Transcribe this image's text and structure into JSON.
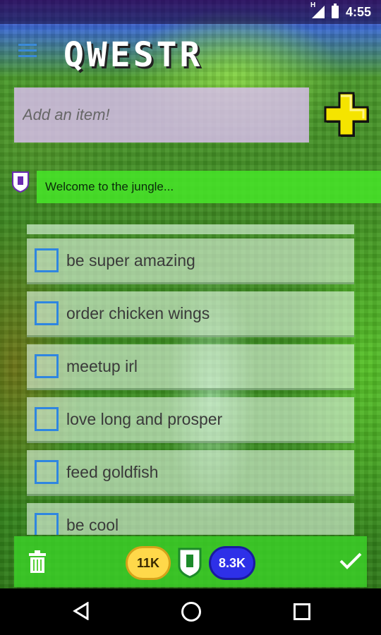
{
  "status_bar": {
    "time": "4:55",
    "network": "H"
  },
  "app": {
    "title": "QWESTR"
  },
  "add_item": {
    "placeholder": "Add an item!"
  },
  "banner": {
    "message": "Welcome to the jungle..."
  },
  "todo_items": [
    {
      "label": "be super amazing",
      "checked": false
    },
    {
      "label": "order chicken wings",
      "checked": false
    },
    {
      "label": "meetup irl",
      "checked": false
    },
    {
      "label": "love long and prosper",
      "checked": false
    },
    {
      "label": "feed goldfish",
      "checked": false
    },
    {
      "label": "be cool",
      "checked": false
    }
  ],
  "bottom_bar": {
    "coins": "11K",
    "points": "8.3K"
  },
  "colors": {
    "accent_blue": "#2f86e0",
    "banner_green": "#46e628",
    "coin_gold": "#ffd84a",
    "points_blue": "#2e30e8",
    "input_lavender": "#dcbef0"
  },
  "icons": [
    "menu-icon",
    "add-plus-icon",
    "shield-logo-icon",
    "trash-icon",
    "checkmark-icon",
    "back-icon",
    "home-icon",
    "recent-apps-icon"
  ]
}
